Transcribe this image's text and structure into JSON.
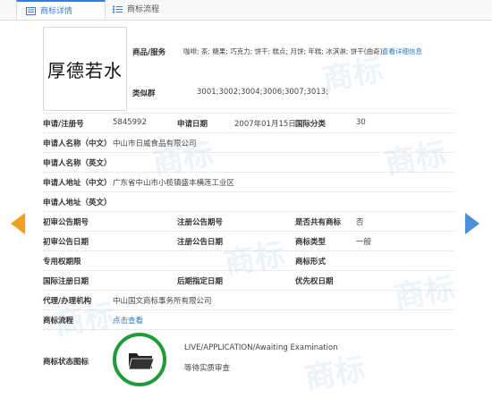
{
  "tabs": [
    {
      "label": "商标详情",
      "icon": "document-icon",
      "active": true
    },
    {
      "label": "商标流程",
      "icon": "list-icon",
      "active": false
    }
  ],
  "logo_text": "厚德若水",
  "goods": {
    "label": "商品/服务",
    "value": "咖啡; 茶; 糖果; 巧克力; 饼干; 糕点; 月饼; 年糕; 冰淇淋; 饼干(曲奇);",
    "link": "查看详细信息"
  },
  "similar_group": {
    "label": "类似群",
    "value": "3001;3002;3004;3006;3007;3013;"
  },
  "application_no": {
    "label": "申请/注册号",
    "value": "5845992"
  },
  "application_date": {
    "label": "申请日期",
    "value": "2007年01月15日"
  },
  "intl_class": {
    "label": "国际分类",
    "value": "30"
  },
  "applicant_cn": {
    "label": "申请人名称（中文）",
    "value": "中山市日威食品有限公司"
  },
  "applicant_en": {
    "label": "申请人名称（英文）",
    "value": ""
  },
  "address_cn": {
    "label": "申请人地址（中文）",
    "value": "广东省中山市小榄镇盛丰横莲工业区"
  },
  "address_en": {
    "label": "申请人地址（英文）",
    "value": ""
  },
  "prelim_pub_no": {
    "label": "初审公告期号",
    "value": ""
  },
  "reg_pub_no": {
    "label": "注册公告期号",
    "value": ""
  },
  "shared": {
    "label": "是否共有商标",
    "value": "否"
  },
  "prelim_pub_date": {
    "label": "初审公告日期",
    "value": ""
  },
  "reg_pub_date": {
    "label": "注册公告日期",
    "value": ""
  },
  "mark_type": {
    "label": "商标类型",
    "value": "一般"
  },
  "exclusive_period": {
    "label": "专用权期限",
    "value": ""
  },
  "mark_form": {
    "label": "商标形式",
    "value": ""
  },
  "intl_reg_date": {
    "label": "国际注册日期",
    "value": ""
  },
  "later_designation": {
    "label": "后期指定日期",
    "value": ""
  },
  "priority_date": {
    "label": "优先权日期",
    "value": ""
  },
  "agent": {
    "label": "代理/办理机构",
    "value": "中山国文商标事务所有限公司"
  },
  "process": {
    "label": "商标流程",
    "link": "点击查看"
  },
  "status": {
    "label": "商标状态图标",
    "status_en": "LIVE/APPLICATION/Awaiting Examination",
    "status_cn": "等待实质审查",
    "icon": "folder-icon",
    "ring_color": "#1f9c3a"
  },
  "watermark_text": "商标",
  "colors": {
    "accent": "#3c7bd6",
    "link": "#2a7ab8",
    "prev_arrow": "#f0a020",
    "next_arrow": "#4a90d9"
  }
}
